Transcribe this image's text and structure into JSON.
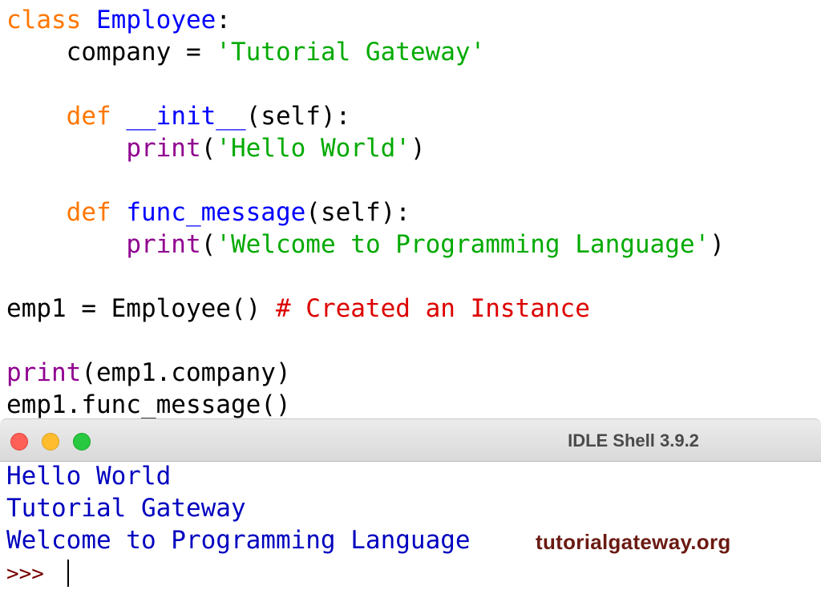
{
  "editor": {
    "lines": [
      [
        {
          "t": "class",
          "c": "kw"
        },
        {
          "t": " ",
          "c": "pl"
        },
        {
          "t": "Employee",
          "c": "def"
        },
        {
          "t": ":",
          "c": "pl"
        }
      ],
      [
        {
          "t": "    company = ",
          "c": "pl"
        },
        {
          "t": "'Tutorial Gateway'",
          "c": "str"
        }
      ],
      [],
      [
        {
          "t": "    ",
          "c": "pl"
        },
        {
          "t": "def",
          "c": "kw"
        },
        {
          "t": " ",
          "c": "pl"
        },
        {
          "t": "__init__",
          "c": "def"
        },
        {
          "t": "(self):",
          "c": "pl"
        }
      ],
      [
        {
          "t": "        ",
          "c": "pl"
        },
        {
          "t": "print",
          "c": "bi"
        },
        {
          "t": "(",
          "c": "pl"
        },
        {
          "t": "'Hello World'",
          "c": "str"
        },
        {
          "t": ")",
          "c": "pl"
        }
      ],
      [],
      [
        {
          "t": "    ",
          "c": "pl"
        },
        {
          "t": "def",
          "c": "kw"
        },
        {
          "t": " ",
          "c": "pl"
        },
        {
          "t": "func_message",
          "c": "def"
        },
        {
          "t": "(self):",
          "c": "pl"
        }
      ],
      [
        {
          "t": "        ",
          "c": "pl"
        },
        {
          "t": "print",
          "c": "bi"
        },
        {
          "t": "(",
          "c": "pl"
        },
        {
          "t": "'Welcome to Programming Language'",
          "c": "str"
        },
        {
          "t": ")",
          "c": "pl"
        }
      ],
      [],
      [
        {
          "t": "emp1 = Employee() ",
          "c": "pl"
        },
        {
          "t": "# Created an Instance",
          "c": "cmt"
        }
      ],
      [],
      [
        {
          "t": "print",
          "c": "bi"
        },
        {
          "t": "(emp1.company)",
          "c": "pl"
        }
      ],
      [
        {
          "t": "emp1.func_message()",
          "c": "pl"
        }
      ]
    ]
  },
  "shell": {
    "title": "IDLE Shell 3.9.2",
    "output": [
      "Hello World",
      "Tutorial Gateway",
      "Welcome to Programming Language"
    ],
    "prompt": ">>> "
  },
  "watermark": "tutorialgateway.org",
  "colors": {
    "keyword": "#ff7700",
    "definition": "#0000ff",
    "string": "#00aa00",
    "builtin": "#900090",
    "comment": "#dd0000",
    "output": "#0000c0",
    "prompt": "#770000"
  }
}
